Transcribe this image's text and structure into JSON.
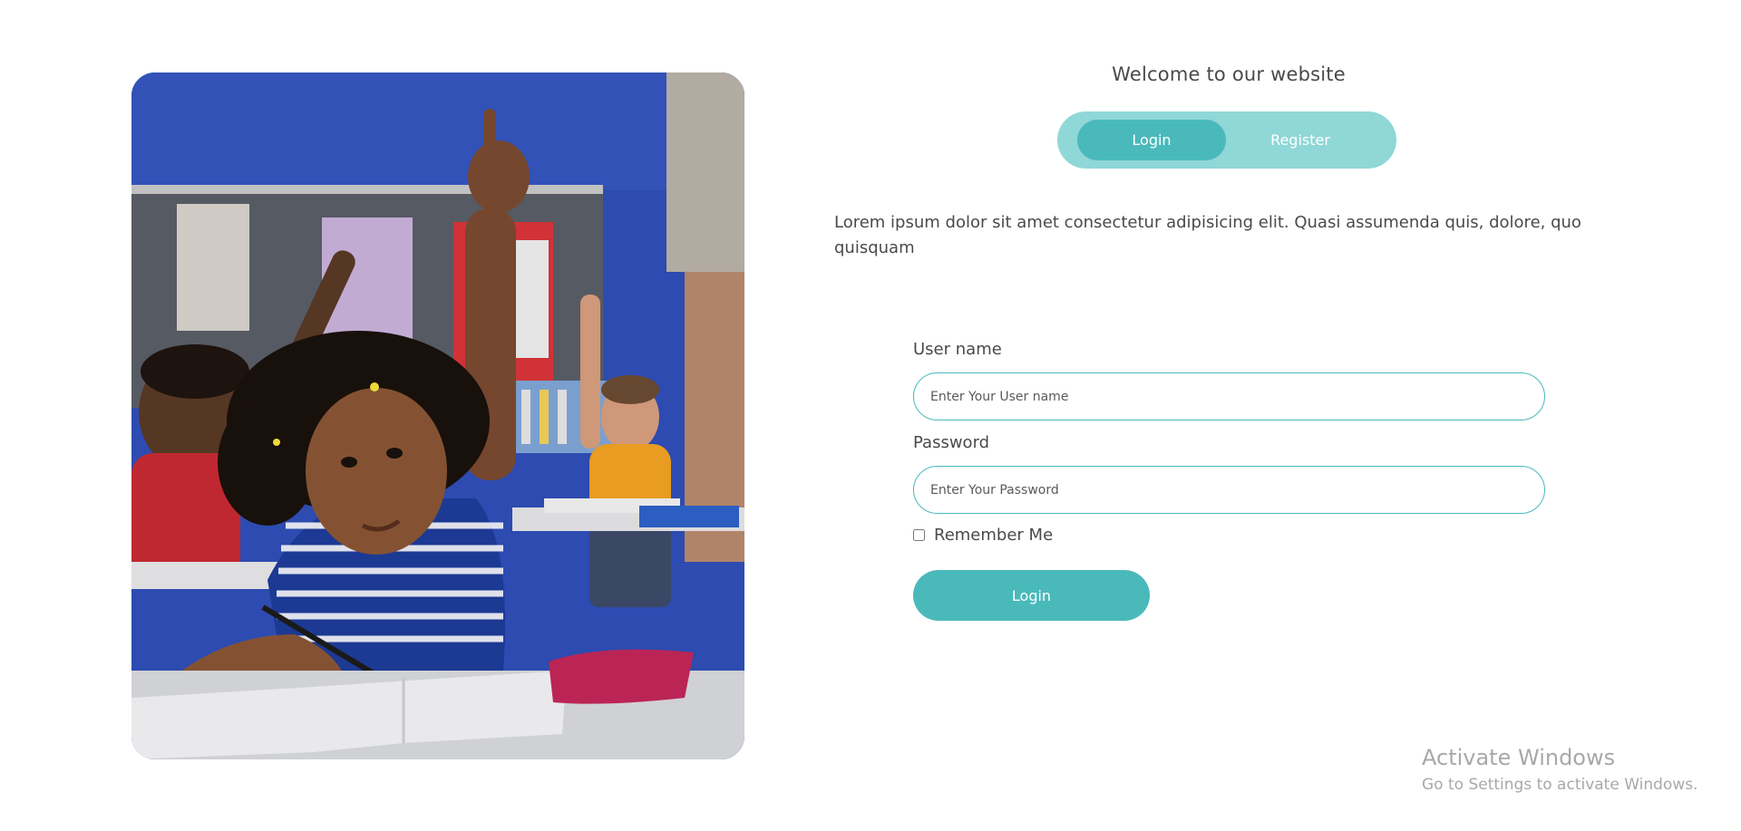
{
  "header": {
    "welcome": "Welcome to our website"
  },
  "tabs": [
    {
      "label": "Login",
      "active": true
    },
    {
      "label": "Register",
      "active": false
    }
  ],
  "intro": "Lorem ipsum dolor sit amet consectetur adipisicing elit. Quasi assumenda quis, dolore, quo quisquam",
  "form": {
    "username_label": "User name",
    "username_placeholder": "Enter Your User name",
    "username_value": "",
    "password_label": "Password",
    "password_placeholder": "Enter Your Password",
    "password_value": "",
    "remember_label": "Remember Me",
    "remember_checked": false,
    "submit_label": "Login"
  },
  "watermark": {
    "title": "Activate Windows",
    "subtitle": "Go to Settings to activate Windows."
  },
  "colors": {
    "accent": "#4ab9ba",
    "tab_track": "#90d7d7",
    "text": "#4a4a4a",
    "watermark": "#a8a8a8"
  },
  "icons": {
    "hero_image": "classroom-photo"
  }
}
